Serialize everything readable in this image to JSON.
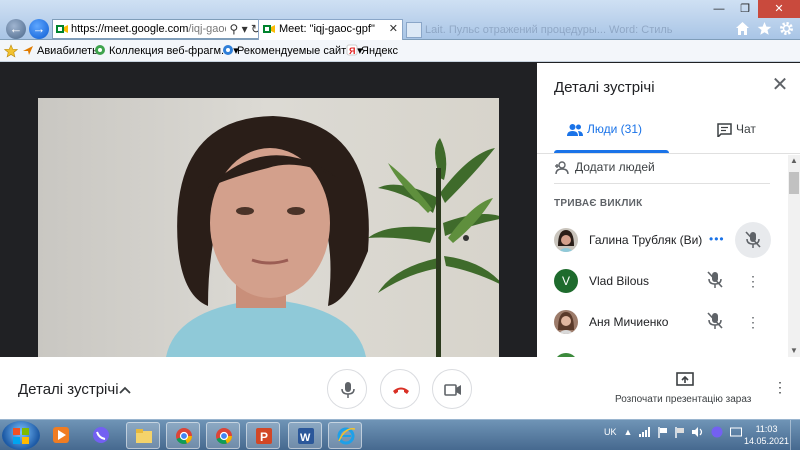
{
  "browser": {
    "address_url_host": "https://meet.google.com",
    "address_url_path": "/iqj-gaoc-",
    "tab_title": "Meet: \"iqj-gaoc-gpf\"",
    "tab_close": "✕",
    "ghost_tab_text": "Lait. Пульс отражений процедуры... Word: Стиль делающих продукта",
    "window_buttons": [
      "—",
      "❐",
      "✕"
    ],
    "tools": [
      "home-icon",
      "star-icon",
      "gear-icon"
    ]
  },
  "favorites_bar": {
    "items": [
      {
        "label": "Авиабилеты",
        "icon": "plane-icon"
      },
      {
        "label": "Коллекция веб-фрагм...",
        "icon": "web-slice-icon"
      },
      {
        "label": "Рекомендуемые сайты",
        "icon": "ie-page-icon"
      },
      {
        "label": "Яндекс",
        "icon": "yandex-icon"
      }
    ]
  },
  "video": {
    "self_label": "Ви",
    "pin_icon": "pin-icon",
    "activity_dots": "•••"
  },
  "panel": {
    "title": "Деталі зустрічі",
    "tab_people": "Люди (31)",
    "tab_chat": "Чат",
    "add_people": "Додати людей",
    "section_header": "ТРИВАЄ ВИКЛИК",
    "participants": [
      {
        "name": "Галина Трубляк (Ви)",
        "avatar": "photo",
        "state": "speaking"
      },
      {
        "name": "Vlad Bilous",
        "avatar": "V",
        "avatar_color": "#1e6b2d",
        "state": "muted"
      },
      {
        "name": "Аня Мичиенко",
        "avatar": "photo",
        "state": "muted"
      }
    ],
    "more_symbol": "⋮",
    "speaking_dots": "•••"
  },
  "bottom_bar": {
    "meeting_details": "Деталі зустрічі",
    "chevron": "^",
    "present_label": "Розпочати презентацію зараз",
    "more_symbol": "⋮",
    "hangup_color": "#d93025"
  },
  "taskbar": {
    "apps": [
      "start",
      "media-player-icon",
      "viber-icon",
      "file-explorer-icon",
      "chrome-icon",
      "chrome-icon",
      "powerpoint-icon",
      "word-icon",
      "internet-explorer-icon"
    ],
    "language": "UK",
    "time": "11:03",
    "date": "14.05.2021"
  }
}
